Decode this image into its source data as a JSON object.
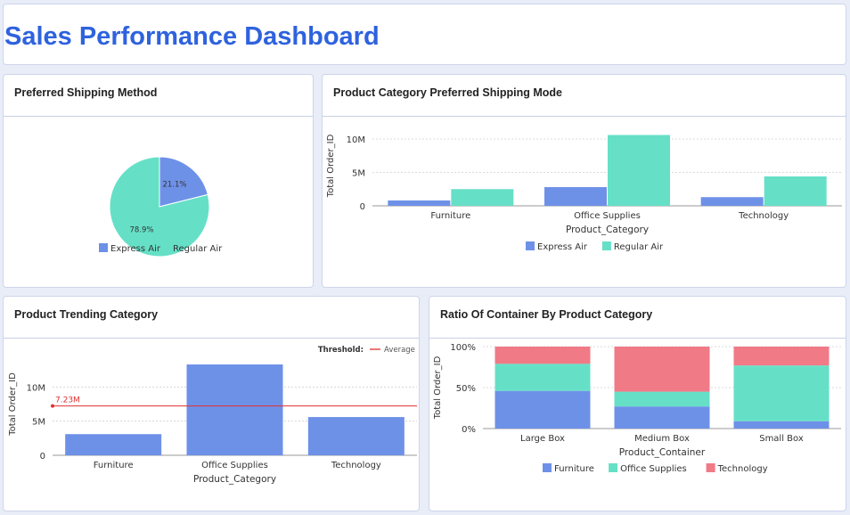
{
  "dashboard": {
    "title": "Sales Performance Dashboard"
  },
  "colors": {
    "express": "#6e91e8",
    "regular": "#65e0c7",
    "furniture": "#6e91e8",
    "office": "#65e0c7",
    "technology": "#f07a86",
    "threshold": "#e03030",
    "title": "#2e62de"
  },
  "chart_data": [
    {
      "id": "pie",
      "type": "pie",
      "title": "Preferred Shipping Method",
      "slices": [
        {
          "name": "Express Air",
          "value": 21.1,
          "label": "21.1%"
        },
        {
          "name": "Regular Air",
          "value": 78.9,
          "label": "78.9%"
        }
      ],
      "legend": [
        "Express Air",
        "Regular Air"
      ],
      "legend_position": "bottom"
    },
    {
      "id": "bar1",
      "type": "bar",
      "title": "Product Category Preferred Shipping Mode",
      "categories": [
        "Furniture",
        "Office Supplies",
        "Technology"
      ],
      "series": [
        {
          "name": "Express Air",
          "values": [
            0.8,
            2.8,
            1.3
          ]
        },
        {
          "name": "Regular Air",
          "values": [
            2.5,
            10.6,
            4.4
          ]
        }
      ],
      "xlabel": "Product_Category",
      "ylabel": "Total Order_ID",
      "ylim": [
        0,
        12
      ],
      "yticks": [
        0,
        5,
        10
      ],
      "ytick_labels": [
        "0",
        "5M",
        "10M"
      ],
      "legend_position": "bottom",
      "grid": true
    },
    {
      "id": "bar2",
      "type": "bar",
      "title": "Product Trending Category",
      "categories": [
        "Furniture",
        "Office Supplies",
        "Technology"
      ],
      "values": [
        3.1,
        13.3,
        5.6
      ],
      "xlabel": "Product_Category",
      "ylabel": "Total Order_ID",
      "ylim": [
        0,
        15
      ],
      "yticks": [
        0,
        5,
        10
      ],
      "ytick_labels": [
        "0",
        "5M",
        "10M"
      ],
      "threshold": {
        "value": 7.23,
        "label": "7.23M",
        "legend_title": "Threshold:",
        "legend_label": "Average"
      },
      "grid": true
    },
    {
      "id": "bar3",
      "type": "bar",
      "stacked": true,
      "title": "Ratio Of Container By Product Category",
      "categories": [
        "Large Box",
        "Medium Box",
        "Small Box"
      ],
      "series": [
        {
          "name": "Furniture",
          "values": [
            46,
            27,
            9
          ]
        },
        {
          "name": "Office Supplies",
          "values": [
            33,
            18,
            68
          ]
        },
        {
          "name": "Technology",
          "values": [
            21,
            55,
            23
          ]
        }
      ],
      "xlabel": "Product_Container",
      "ylabel": "Total Order_ID",
      "ylim": [
        0,
        100
      ],
      "yticks": [
        0,
        50,
        100
      ],
      "ytick_labels": [
        "0%",
        "50%",
        "100%"
      ],
      "legend_position": "bottom",
      "grid": true
    }
  ]
}
